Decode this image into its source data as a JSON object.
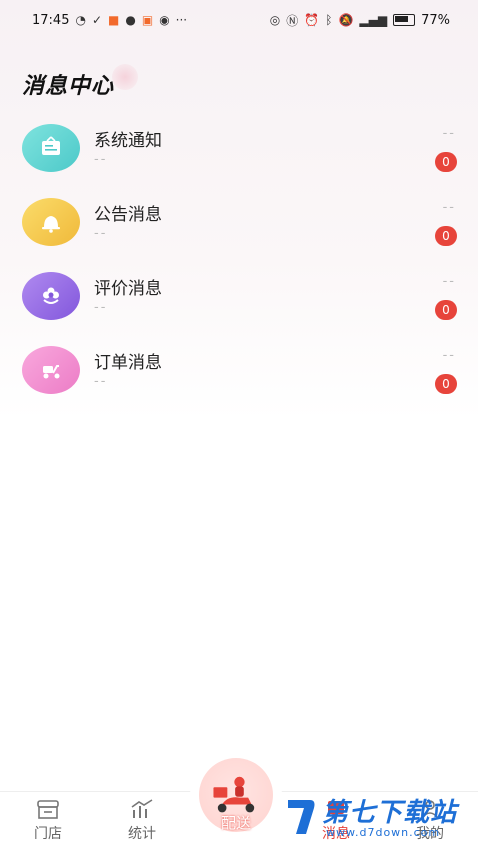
{
  "status_bar": {
    "time": "17:45",
    "left_icons": [
      "wechat-like-icon",
      "link-icon",
      "mail-icon",
      "chat-icon",
      "app-icon",
      "audio-icon",
      "more-icon"
    ],
    "right_icons": [
      "eye-icon",
      "nfc-icon",
      "alarm-icon",
      "bluetooth-icon",
      "mute-icon",
      "signal-icon"
    ],
    "battery": "77%"
  },
  "page": {
    "title": "消息中心"
  },
  "messages": [
    {
      "title": "系统通知",
      "subtitle": "--",
      "time": "--",
      "badge": "0",
      "icon": "notice-board-icon",
      "color": "#5fd3d0"
    },
    {
      "title": "公告消息",
      "subtitle": "--",
      "time": "--",
      "badge": "0",
      "icon": "bell-icon",
      "color": "#f3c94b"
    },
    {
      "title": "评价消息",
      "subtitle": "--",
      "time": "--",
      "badge": "0",
      "icon": "flower-icon",
      "color": "#9a6ee6"
    },
    {
      "title": "订单消息",
      "subtitle": "--",
      "time": "--",
      "badge": "0",
      "icon": "scooter-icon",
      "color": "#f28ed0"
    }
  ],
  "tabbar": {
    "store": "门店",
    "stats": "统计",
    "delivery": "配送",
    "messages": "消息",
    "mine": "我的"
  },
  "watermark": {
    "name": "第七下载站",
    "url": "www.d7down.com"
  },
  "colors": {
    "badge": "#e7443b",
    "accent": "#e7443b"
  }
}
